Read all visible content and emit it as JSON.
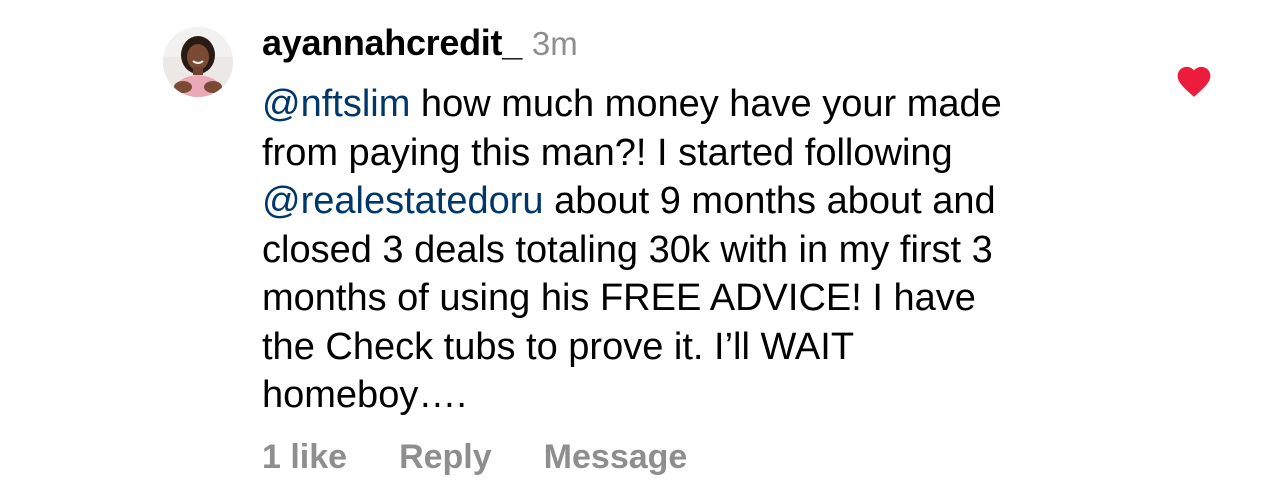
{
  "comment": {
    "username": "ayannahcredit_",
    "time": "3m",
    "lines": [
      [
        {
          "mention": "@nftslim"
        },
        {
          "text": " how much money have your made"
        }
      ],
      [
        {
          "text": "from paying this man?! I started following"
        }
      ],
      [
        {
          "mention": "@realestatedoru"
        },
        {
          "text": "  about 9 months about and"
        }
      ],
      [
        {
          "text": "closed 3 deals totaling 30k with in my first 3"
        }
      ],
      [
        {
          "text": "months of  using his FREE ADVICE!  I have"
        }
      ],
      [
        {
          "text": "the Check tubs to prove it. I’ll WAIT"
        }
      ],
      [
        {
          "text": "homeboy…."
        }
      ]
    ],
    "likes_label": "1 like",
    "reply_label": "Reply",
    "message_label": "Message",
    "liked": true
  },
  "icons": {
    "heart": "heart-filled-icon",
    "avatar": "profile-avatar"
  },
  "colors": {
    "mention": "#00376b",
    "secondary_text": "#8e8e8e",
    "heart": "#ed1c3c"
  }
}
